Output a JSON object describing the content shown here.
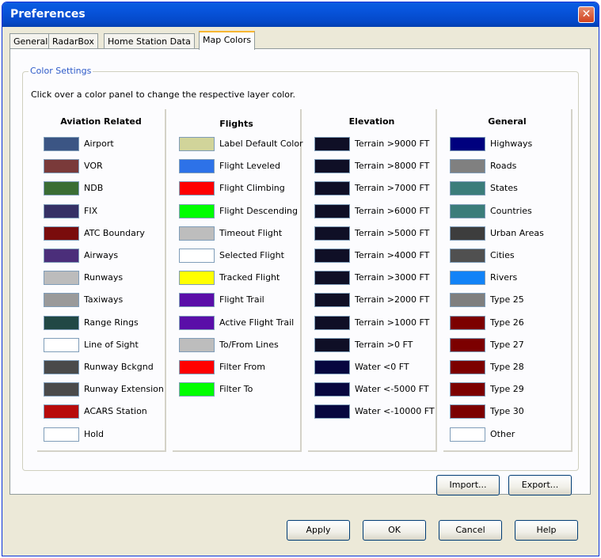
{
  "window": {
    "title": "Preferences",
    "close_symbol": "✕"
  },
  "tabs": [
    {
      "label": "General",
      "active": false
    },
    {
      "label": "RadarBox",
      "active": false
    },
    {
      "label": "Home Station Data",
      "active": false
    },
    {
      "label": "Map Colors",
      "active": true
    }
  ],
  "group": {
    "label": "Color Settings",
    "instruction": "Click over a color panel to change the respective layer color."
  },
  "columns": [
    {
      "header": "Aviation Related",
      "items": [
        {
          "label": "Airport",
          "color": "#3b5584"
        },
        {
          "label": "VOR",
          "color": "#7a3a3a"
        },
        {
          "label": "NDB",
          "color": "#3a6d34"
        },
        {
          "label": "FIX",
          "color": "#353065"
        },
        {
          "label": "ATC Boundary",
          "color": "#7a0c0c"
        },
        {
          "label": "Airways",
          "color": "#4b2e7a"
        },
        {
          "label": "Runways",
          "color": "#bcbcbc"
        },
        {
          "label": "Taxiways",
          "color": "#9a9a9a"
        },
        {
          "label": "Range Rings",
          "color": "#214845"
        },
        {
          "label": "Line of Sight",
          "color": "#ffffff"
        },
        {
          "label": "Runway Bckgnd",
          "color": "#4a4a4a"
        },
        {
          "label": "Runway Extension",
          "color": "#4a4a4a"
        },
        {
          "label": "ACARS Station",
          "color": "#b80b0b"
        },
        {
          "label": "Hold",
          "color": "#ffffff"
        }
      ]
    },
    {
      "header": "Flights",
      "items": [
        {
          "label": "Label Default Color",
          "color": "#d1d49a"
        },
        {
          "label": "Flight Leveled",
          "color": "#2d72e8"
        },
        {
          "label": "Flight Climbing",
          "color": "#ff0000"
        },
        {
          "label": "Flight Descending",
          "color": "#00ff00"
        },
        {
          "label": "Timeout Flight",
          "color": "#bdbdbd"
        },
        {
          "label": "Selected Flight",
          "color": "#ffffff"
        },
        {
          "label": "Tracked Flight",
          "color": "#ffff00"
        },
        {
          "label": "Flight Trail",
          "color": "#5a0ea8"
        },
        {
          "label": "Active Flight Trail",
          "color": "#5a0ea8"
        },
        {
          "label": "To/From Lines",
          "color": "#bdbdbd"
        },
        {
          "label": "Filter From",
          "color": "#ff0000"
        },
        {
          "label": "Filter To",
          "color": "#00ff00"
        }
      ]
    },
    {
      "header": "Elevation",
      "items": [
        {
          "label": "Terrain >9000 FT",
          "color": "#0f0f26"
        },
        {
          "label": "Terrain >8000 FT",
          "color": "#0f0f26"
        },
        {
          "label": "Terrain >7000 FT",
          "color": "#0f0f26"
        },
        {
          "label": "Terrain >6000 FT",
          "color": "#0f0f26"
        },
        {
          "label": "Terrain >5000 FT",
          "color": "#0f0f26"
        },
        {
          "label": "Terrain >4000 FT",
          "color": "#0f0f26"
        },
        {
          "label": "Terrain >3000 FT",
          "color": "#0f0f26"
        },
        {
          "label": "Terrain >2000 FT",
          "color": "#0f0f26"
        },
        {
          "label": "Terrain >1000 FT",
          "color": "#0f0f26"
        },
        {
          "label": "Terrain >0 FT",
          "color": "#0f0f26"
        },
        {
          "label": "Water <0 FT",
          "color": "#07073f"
        },
        {
          "label": "Water <-5000 FT",
          "color": "#07073f"
        },
        {
          "label": "Water <-10000 FT",
          "color": "#07073f"
        }
      ]
    },
    {
      "header": "General",
      "items": [
        {
          "label": "Highways",
          "color": "#00007e"
        },
        {
          "label": "Roads",
          "color": "#808080"
        },
        {
          "label": "States",
          "color": "#3b7d7a"
        },
        {
          "label": "Countries",
          "color": "#3b7d7a"
        },
        {
          "label": "Urban Areas",
          "color": "#3d3d3d"
        },
        {
          "label": "Cities",
          "color": "#505050"
        },
        {
          "label": "Rivers",
          "color": "#1283f7"
        },
        {
          "label": "Type 25",
          "color": "#7f7f7f"
        },
        {
          "label": "Type 26",
          "color": "#7c0000"
        },
        {
          "label": "Type 27",
          "color": "#7c0000"
        },
        {
          "label": "Type 28",
          "color": "#7c0000"
        },
        {
          "label": "Type 29",
          "color": "#7c0000"
        },
        {
          "label": "Type 30",
          "color": "#7c0000"
        },
        {
          "label": "Other",
          "color": "#ffffff"
        }
      ]
    }
  ],
  "buttons": {
    "import": "Import...",
    "export": "Export...",
    "apply": "Apply",
    "ok": "OK",
    "cancel": "Cancel",
    "help": "Help"
  }
}
